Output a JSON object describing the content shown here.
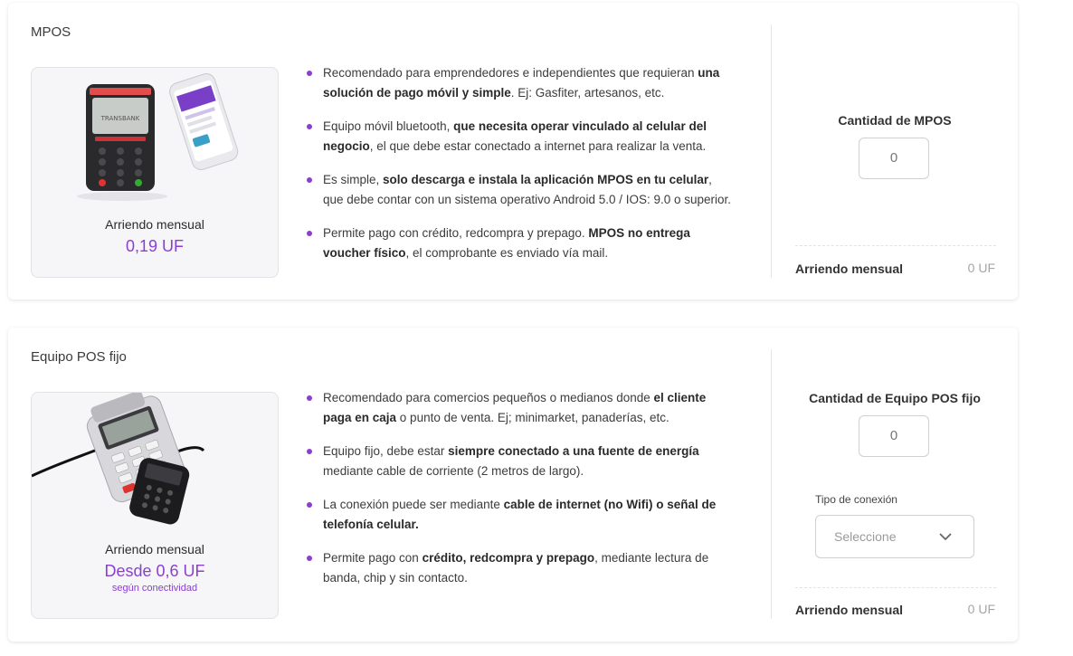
{
  "products": [
    {
      "title": "MPOS",
      "image": "mpos-terminal-and-phone",
      "price_label": "Arriendo mensual",
      "price_value": "0,19 UF",
      "features": [
        [
          {
            "t": "Recomendado para emprendedores e independientes que requieran "
          },
          {
            "t": "una solución de pago móvil y simple",
            "b": true
          },
          {
            "t": ". Ej: Gasfiter, artesanos, etc."
          }
        ],
        [
          {
            "t": "Equipo móvil bluetooth, "
          },
          {
            "t": "que necesita operar vinculado al celular del negocio",
            "b": true
          },
          {
            "t": ", el que debe estar conectado a internet para realizar la venta."
          }
        ],
        [
          {
            "t": "Es simple, "
          },
          {
            "t": "solo descarga e instala la aplicación MPOS en tu celular",
            "b": true
          },
          {
            "t": ", que debe contar con un sistema operativo Android 5.0 / IOS: 9.0 o superior."
          }
        ],
        [
          {
            "t": "Permite pago con crédito, redcompra y prepago. "
          },
          {
            "t": "MPOS no entrega voucher físico",
            "b": true
          },
          {
            "t": ", el comprobante es enviado vía mail."
          }
        ]
      ],
      "qty_label": "Cantidad de MPOS",
      "qty_value": "0",
      "total_label": "Arriendo mensual",
      "total_value": "0 UF"
    },
    {
      "title": "Equipo POS fijo",
      "image": "fixed-pos-terminal",
      "price_label": "Arriendo mensual",
      "price_value": "Desde 0,6 UF",
      "price_note": "según conectividad",
      "features": [
        [
          {
            "t": "Recomendado para comercios pequeños o medianos donde "
          },
          {
            "t": "el cliente paga en caja",
            "b": true
          },
          {
            "t": " o punto de venta. Ej; minimarket, panaderías, etc."
          }
        ],
        [
          {
            "t": "Equipo fijo, debe estar "
          },
          {
            "t": "siempre conectado a una fuente de energía",
            "b": true
          },
          {
            "t": " mediante cable de corriente (2 metros de largo)."
          }
        ],
        [
          {
            "t": "La conexión puede ser mediante "
          },
          {
            "t": "cable de internet (no Wifi) o señal de telefonía celular.",
            "b": true
          }
        ],
        [
          {
            "t": "Permite pago con "
          },
          {
            "t": "crédito, redcompra y prepago",
            "b": true
          },
          {
            "t": ", mediante lectura de banda, chip y sin contacto."
          }
        ]
      ],
      "qty_label": "Cantidad de Equipo POS fijo",
      "qty_value": "0",
      "connection_label": "Tipo de conexión",
      "connection_placeholder": "Seleccione",
      "total_label": "Arriendo mensual",
      "total_value": "0 UF"
    }
  ],
  "colors": {
    "accent": "#8a3fd1",
    "muted": "#a5a5a5",
    "card_bg": "#ffffff",
    "image_bg": "#f6f6f8"
  }
}
